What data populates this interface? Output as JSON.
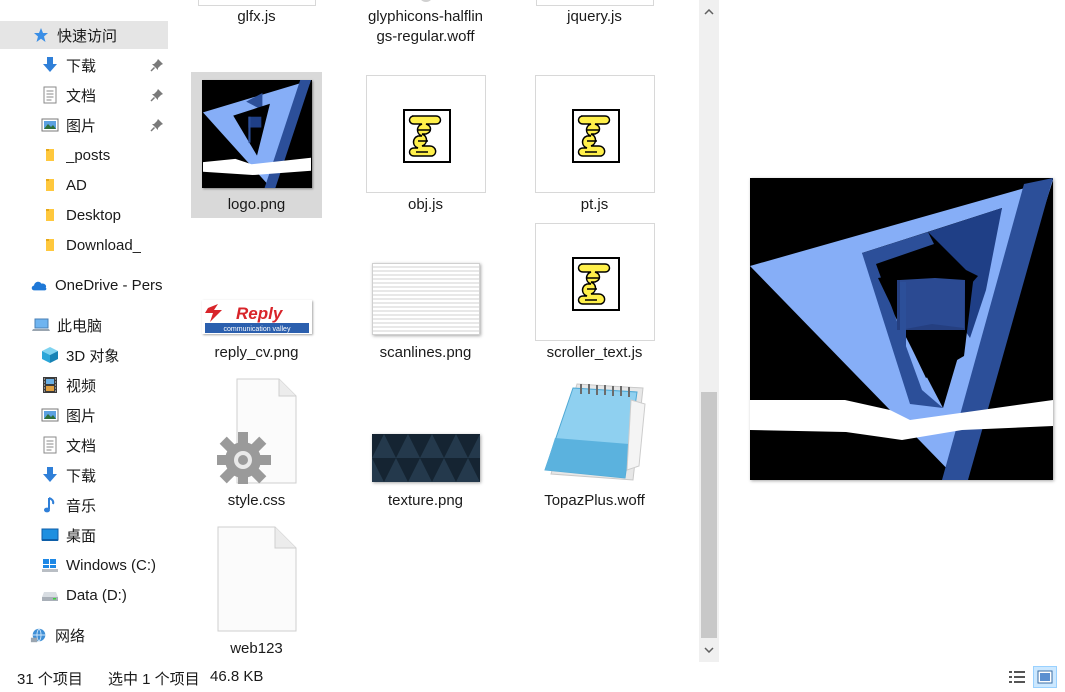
{
  "nav": {
    "quick_access": "快速访问",
    "downloads_pinned": "下载",
    "documents_pinned": "文档",
    "pictures_pinned": "图片",
    "posts": "_posts",
    "ad": "AD",
    "desktop_pinned": "Desktop",
    "download_folder": "Download_",
    "onedrive": "OneDrive - Pers",
    "this_pc": "此电脑",
    "objects_3d": "3D 对象",
    "videos": "视频",
    "pictures": "图片",
    "documents": "文档",
    "downloads": "下载",
    "music": "音乐",
    "desktop": "桌面",
    "drive_c": "Windows (C:)",
    "drive_d": "Data (D:)",
    "network": "网络"
  },
  "files": {
    "glfx": "glfx.js",
    "glyph": "glyphicons-halflings-regular.woff",
    "jquery": "jquery.js",
    "logo": "logo.png",
    "obj": "obj.js",
    "pt": "pt.js",
    "reply": "reply_cv.png",
    "scanlines": "scanlines.png",
    "scroller": "scroller_text.js",
    "style": "style.css",
    "texture": "texture.png",
    "topaz": "TopazPlus.woff",
    "web123": "web123"
  },
  "reply_logo": {
    "brand": "Reply",
    "tagline": "communication valley"
  },
  "status": {
    "item_count": "31 个项目",
    "selection": "选中 1 个项目",
    "size": "46.8 KB"
  },
  "colors": {
    "selection_bg": "#d9d9d9",
    "nav_selected_bg": "#e5e5e5",
    "folder": "#ffc83d",
    "logo_light_blue": "#86aef7",
    "logo_dark_blue": "#2c4f99",
    "reply_red": "#d8242a"
  }
}
